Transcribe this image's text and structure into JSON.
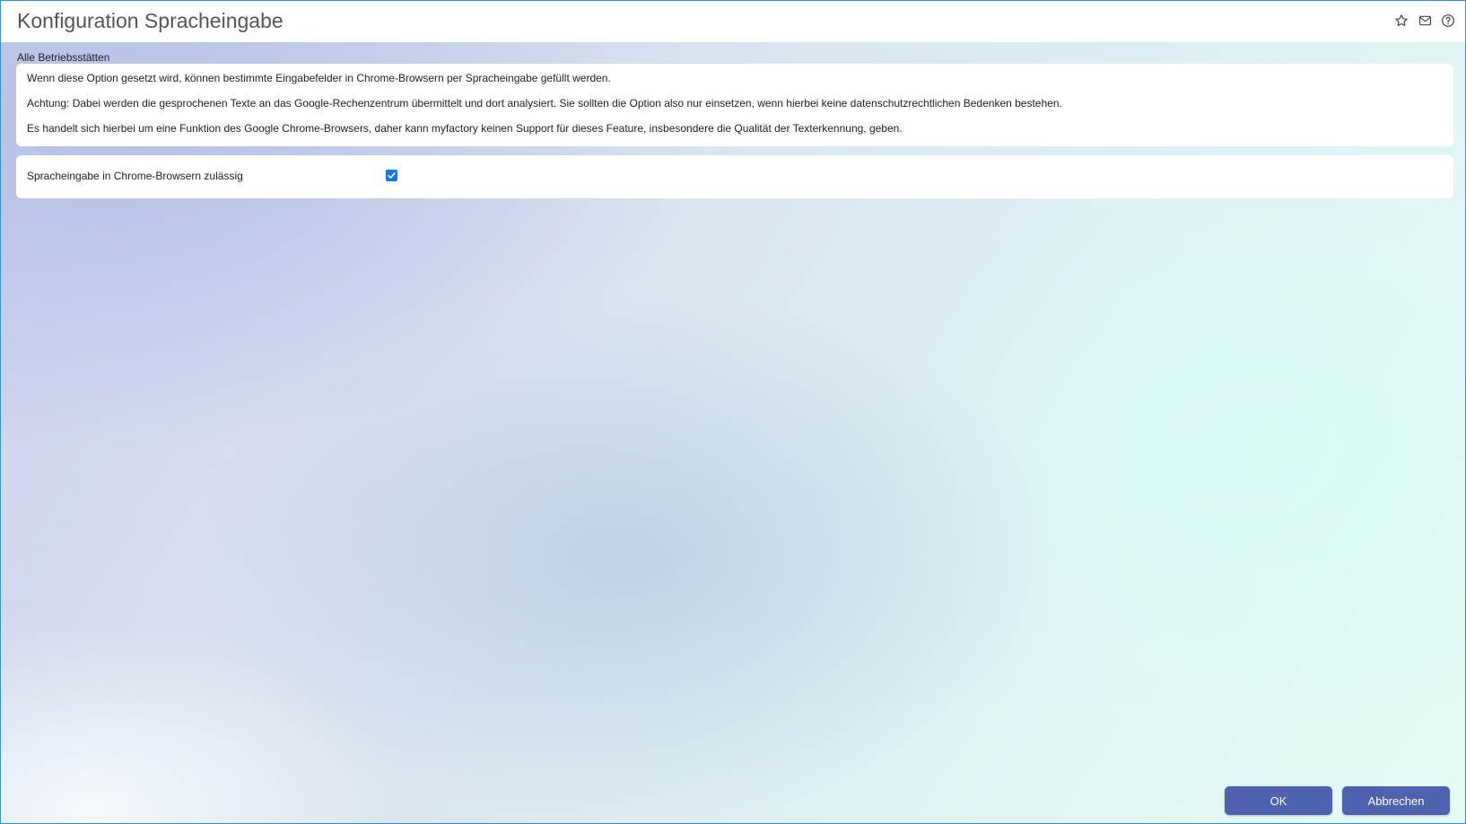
{
  "window": {
    "title": "Konfiguration Spracheingabe",
    "icons": [
      "star-icon",
      "mail-icon",
      "help-icon"
    ]
  },
  "scope": {
    "label": "Alle Betriebsstätten"
  },
  "info": {
    "paragraphs": [
      "Wenn diese Option gesetzt wird, können bestimmte Eingabefelder in Chrome-Browsern per Spracheingabe gefüllt werden.",
      "Achtung: Dabei werden die gesprochenen Texte an das Google-Rechenzentrum übermittelt und dort analysiert. Sie sollten die Option also nur einsetzen, wenn hierbei keine datenschutzrechtlichen Bedenken bestehen.",
      "Es handelt sich hierbei um eine Funktion des Google Chrome-Browsers, daher kann myfactory keinen Support für dieses Feature, insbesondere die Qualität der Texterkennung, geben."
    ]
  },
  "option": {
    "label": "Spracheingabe in Chrome-Browsern zulässig",
    "checked": true
  },
  "buttons": {
    "ok_label": "OK",
    "cancel_label": "Abbrechen"
  },
  "colors": {
    "accent": "#4e63b0",
    "checkbox": "#1a73e8",
    "border": "#3a8fc4"
  }
}
